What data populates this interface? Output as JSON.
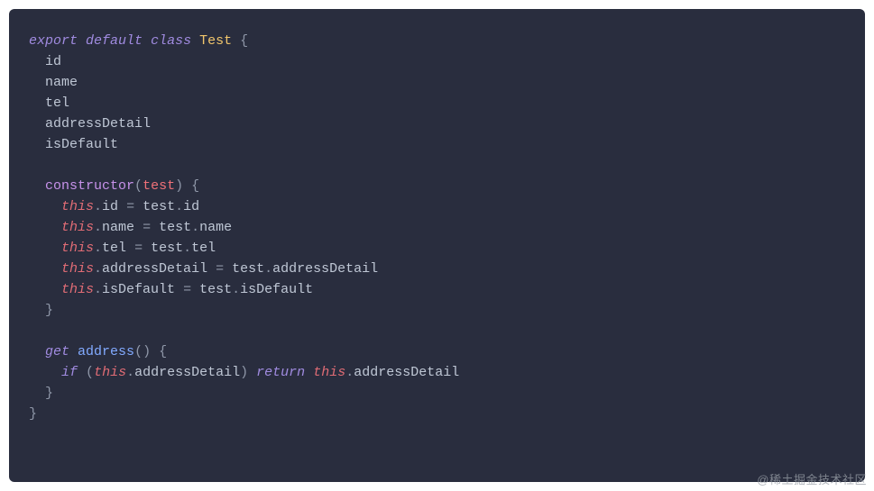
{
  "watermark": "@稀土掘金技术社区",
  "code": {
    "kw_export": "export",
    "kw_default": "default",
    "kw_class": "class",
    "cls_name": "Test",
    "brace_open": "{",
    "brace_close": "}",
    "paren_open": "(",
    "paren_close": ")",
    "dot": ".",
    "eq": "=",
    "field_id": "id",
    "field_name": "name",
    "field_tel": "tel",
    "field_addressDetail": "addressDetail",
    "field_isDefault": "isDefault",
    "ctor": "constructor",
    "param_test": "test",
    "kw_this": "this",
    "kw_get": "get",
    "method_address": "address",
    "kw_if": "if",
    "kw_return": "return"
  }
}
